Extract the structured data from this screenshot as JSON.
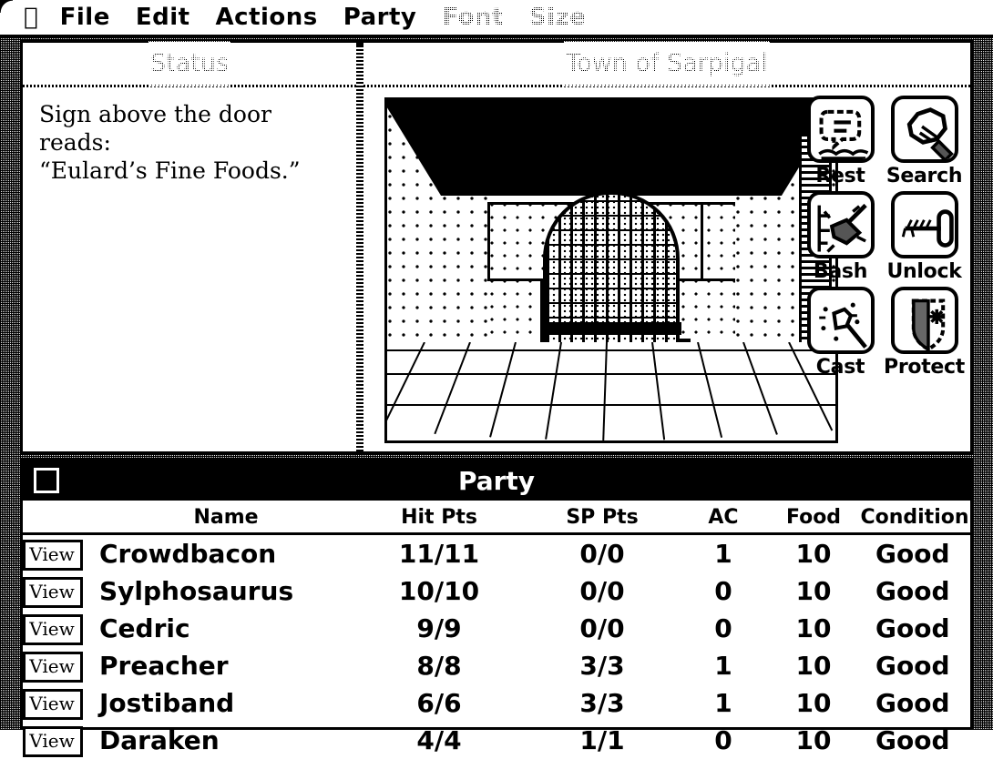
{
  "menubar": {
    "apple_icon": "apple-icon",
    "items": [
      {
        "label": "File",
        "enabled": true
      },
      {
        "label": "Edit",
        "enabled": true
      },
      {
        "label": "Actions",
        "enabled": true
      },
      {
        "label": "Party",
        "enabled": true
      },
      {
        "label": "Font",
        "enabled": false
      },
      {
        "label": "Size",
        "enabled": false
      }
    ]
  },
  "status_pane": {
    "title": "Status",
    "lines": [
      "Sign above the door",
      "reads:",
      "“Eulard’s Fine Foods.”"
    ]
  },
  "game_pane": {
    "title": "Town of Sarpigal",
    "viewport_description": "first-person dungeon view of stone block walls with an arched iron gate"
  },
  "actions": [
    {
      "label": "Rest",
      "icon": "bed-icon"
    },
    {
      "label": "Search",
      "icon": "magnifier-icon"
    },
    {
      "label": "Bash",
      "icon": "hammer-icon"
    },
    {
      "label": "Unlock",
      "icon": "key-icon"
    },
    {
      "label": "Cast",
      "icon": "wand-icon"
    },
    {
      "label": "Protect",
      "icon": "shield-icon"
    }
  ],
  "party": {
    "title": "Party",
    "view_label": "View",
    "columns": [
      "Name",
      "Hit Pts",
      "SP Pts",
      "AC",
      "Food",
      "Condition"
    ],
    "rows": [
      {
        "name": "Crowdbacon",
        "hit_pts": "11/11",
        "sp_pts": "0/0",
        "ac": "1",
        "food": "10",
        "condition": "Good"
      },
      {
        "name": "Sylphosaurus",
        "hit_pts": "10/10",
        "sp_pts": "0/0",
        "ac": "0",
        "food": "10",
        "condition": "Good"
      },
      {
        "name": "Cedric",
        "hit_pts": "9/9",
        "sp_pts": "0/0",
        "ac": "0",
        "food": "10",
        "condition": "Good"
      },
      {
        "name": "Preacher",
        "hit_pts": "8/8",
        "sp_pts": "3/3",
        "ac": "1",
        "food": "10",
        "condition": "Good"
      },
      {
        "name": "Jostiband",
        "hit_pts": "6/6",
        "sp_pts": "3/3",
        "ac": "1",
        "food": "10",
        "condition": "Good"
      },
      {
        "name": "Daraken",
        "hit_pts": "4/4",
        "sp_pts": "1/1",
        "ac": "0",
        "food": "10",
        "condition": "Good"
      }
    ]
  },
  "colors": {
    "ink": "#000000",
    "paper": "#ffffff"
  }
}
